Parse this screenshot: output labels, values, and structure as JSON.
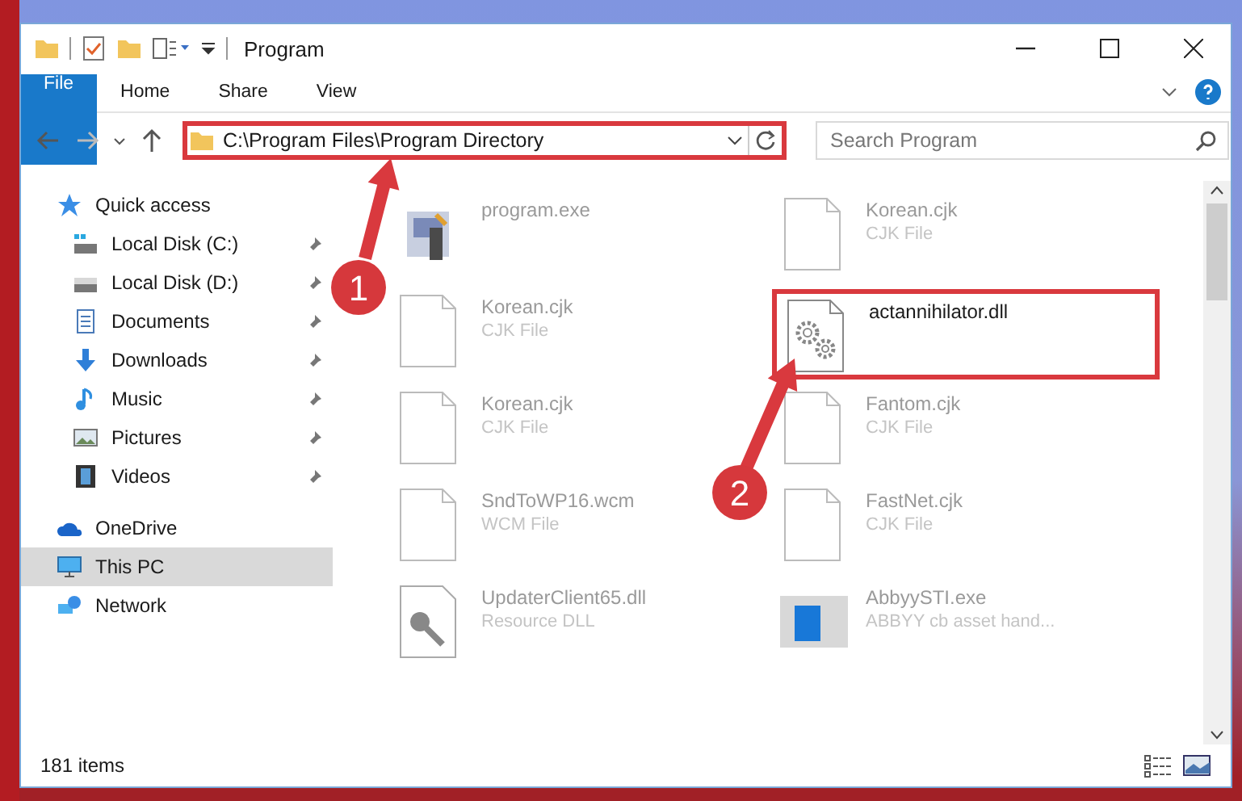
{
  "window": {
    "title": "Program"
  },
  "ribbon_tabs": [
    {
      "label": "File",
      "kind": "file",
      "selected": false
    },
    {
      "label": "Home",
      "kind": "tab",
      "selected": false
    },
    {
      "label": "Share",
      "kind": "tab",
      "selected": false
    },
    {
      "label": "View",
      "kind": "tab",
      "selected": false
    }
  ],
  "address_bar": {
    "path": "C:\\Program Files\\Program Directory",
    "highlighted": true
  },
  "search": {
    "placeholder": "Search Program"
  },
  "sidebar": {
    "items": [
      {
        "label": "Quick access",
        "kind": "group",
        "pinned": false,
        "selected": false
      },
      {
        "label": "Local Disk (C:)",
        "kind": "item",
        "pinned": true,
        "selected": false
      },
      {
        "label": "Local Disk (D:)",
        "kind": "item",
        "pinned": true,
        "selected": false
      },
      {
        "label": "Documents",
        "kind": "item",
        "pinned": true,
        "selected": false
      },
      {
        "label": "Downloads",
        "kind": "item",
        "pinned": true,
        "selected": false
      },
      {
        "label": "Music",
        "kind": "item",
        "pinned": true,
        "selected": false
      },
      {
        "label": "Pictures",
        "kind": "item",
        "pinned": true,
        "selected": false
      },
      {
        "label": "Videos",
        "kind": "item",
        "pinned": true,
        "selected": false
      },
      {
        "label": "OneDrive",
        "kind": "group",
        "pinned": false,
        "selected": false
      },
      {
        "label": "This PC",
        "kind": "group",
        "pinned": false,
        "selected": true
      },
      {
        "label": "Network",
        "kind": "group",
        "pinned": false,
        "selected": false
      }
    ]
  },
  "files": [
    {
      "name": "program.exe",
      "kind": "exe",
      "blurred": true,
      "highlighted": false
    },
    {
      "name": "Korean.cjk",
      "type": "CJK File",
      "kind": "doc",
      "blurred": true,
      "highlighted": false
    },
    {
      "name": "Korean.cjk",
      "type": "CJK File",
      "kind": "doc",
      "blurred": true,
      "highlighted": false
    },
    {
      "name": "actannihilator.dll",
      "kind": "gear",
      "blurred": false,
      "highlighted": true
    },
    {
      "name": "Korean.cjk",
      "type": "CJK File",
      "kind": "doc",
      "blurred": true,
      "highlighted": false
    },
    {
      "name": "Fantom.cjk",
      "type": "CJK File",
      "kind": "doc",
      "blurred": true,
      "highlighted": false
    },
    {
      "name": "SndToWP16.wcm",
      "type": "WCM File",
      "kind": "doc",
      "blurred": true,
      "highlighted": false
    },
    {
      "name": "FastNet.cjk",
      "type": "CJK File",
      "kind": "doc",
      "blurred": true,
      "highlighted": false
    },
    {
      "name": "UpdaterClient65.dll",
      "type": "Resource DLL",
      "kind": "wrench",
      "blurred": true,
      "highlighted": false
    },
    {
      "name": "AbbyySTI.exe",
      "type": "ABBYY cb asset hand...",
      "kind": "app",
      "blurred": true,
      "highlighted": false
    }
  ],
  "callouts": [
    {
      "number": "1"
    },
    {
      "number": "2"
    }
  ],
  "status_bar": {
    "count": "181 items"
  }
}
